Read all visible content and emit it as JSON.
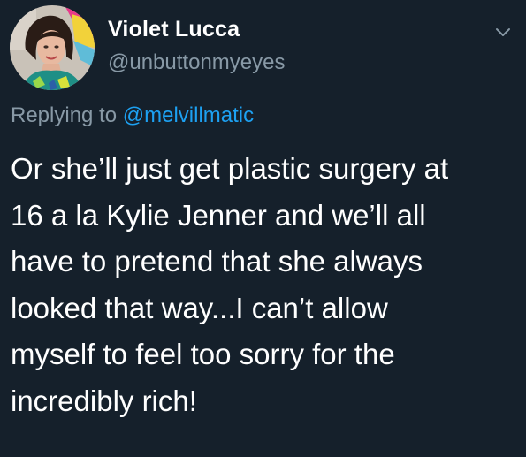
{
  "author": {
    "name": "Violet Lucca",
    "handle": "@unbuttonmyeyes",
    "avatar_icon": "profile-photo"
  },
  "reply": {
    "prefix": "Replying to",
    "mention": "@melvillmatic"
  },
  "tweet": {
    "lines": [
      "Or she’ll just get plastic surgery at",
      "16 a la Kylie Jenner and we’ll all",
      "have to pretend that she always",
      "looked that way...I can’t allow",
      "myself to feel too sorry for the",
      "incredibly rich!"
    ]
  },
  "menu": {
    "icon": "chevron-down-icon"
  },
  "colors": {
    "background": "#15202b",
    "primary_text": "#ffffff",
    "secondary_text": "#8899a6",
    "link": "#1da1f2"
  }
}
